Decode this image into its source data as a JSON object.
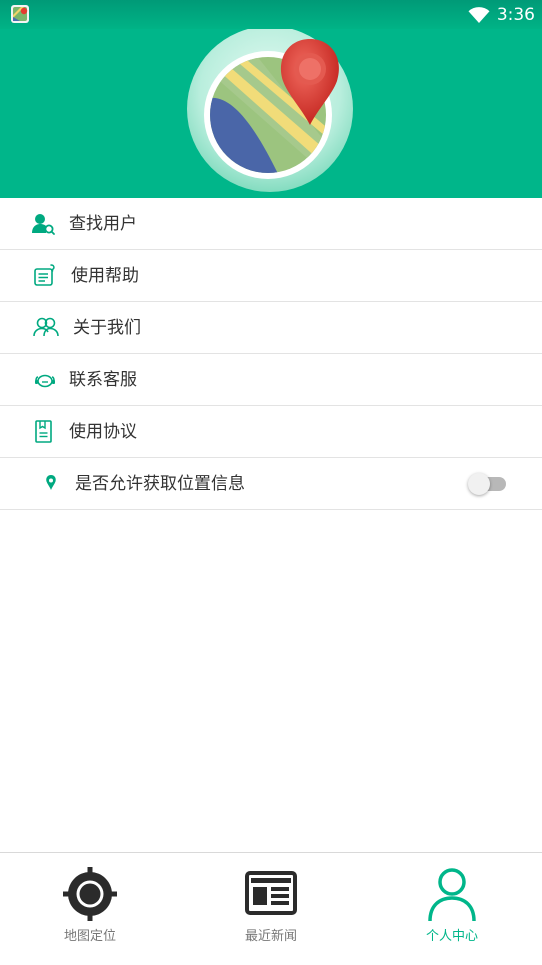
{
  "status_bar": {
    "time": "3:36"
  },
  "header": {
    "logo_icon": "map-pin-logo-icon",
    "brand_color": "#00b68a"
  },
  "menu": {
    "items": [
      {
        "label": "查找用户",
        "icon": "find-user-icon"
      },
      {
        "label": "使用帮助",
        "icon": "help-icon"
      },
      {
        "label": "关于我们",
        "icon": "about-us-icon"
      },
      {
        "label": "联系客服",
        "icon": "customer-service-icon"
      },
      {
        "label": "使用协议",
        "icon": "agreement-icon"
      },
      {
        "label": "是否允许获取位置信息",
        "icon": "location-pin-icon",
        "toggle_on": false
      }
    ]
  },
  "bottom_nav": {
    "items": [
      {
        "label": "地图定位",
        "icon": "crosshair-icon",
        "active": false
      },
      {
        "label": "最近新闻",
        "icon": "newspaper-icon",
        "active": false
      },
      {
        "label": "个人中心",
        "icon": "person-icon",
        "active": true
      }
    ],
    "active_color": "#00b68a",
    "inactive_color": "#777777"
  }
}
